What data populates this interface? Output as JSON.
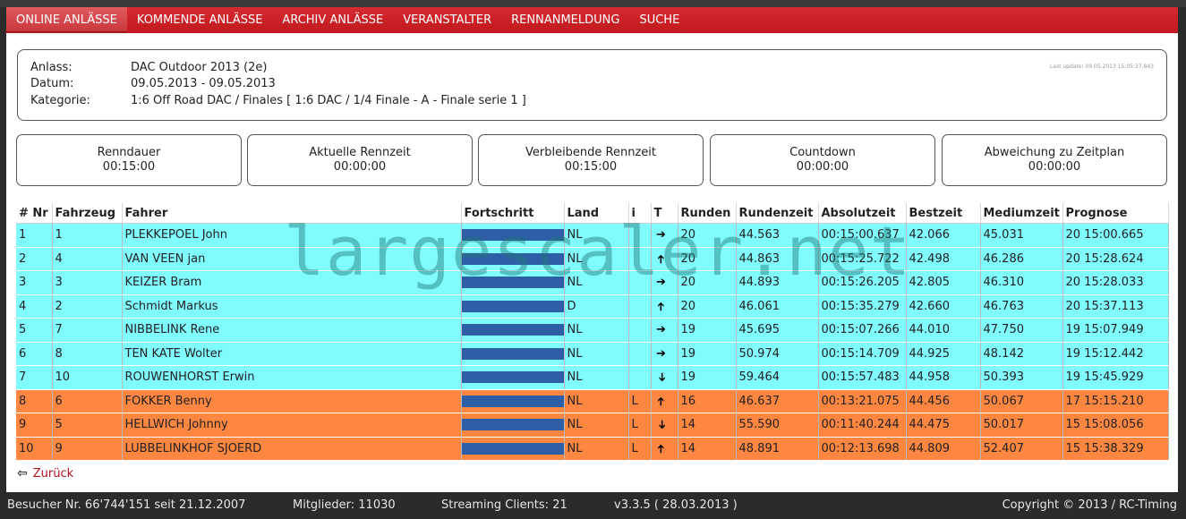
{
  "nav": {
    "items": [
      {
        "label": "ONLINE ANLÄSSE",
        "active": true
      },
      {
        "label": "KOMMENDE ANLÄSSE",
        "active": false
      },
      {
        "label": "ARCHIV ANLÄSSE",
        "active": false
      },
      {
        "label": "VERANSTALTER",
        "active": false
      },
      {
        "label": "RENNANMELDUNG",
        "active": false
      },
      {
        "label": "SUCHE",
        "active": false
      }
    ]
  },
  "info": {
    "anlass_label": "Anlass:",
    "anlass_value": "DAC Outdoor 2013 (2e)",
    "datum_label": "Datum:",
    "datum_value": "09.05.2013 - 09.05.2013",
    "kategorie_label": "Kategorie:",
    "kategorie_value": "1:6 Off Road DAC / Finales [ 1:6 DAC / 1/4 Finale - A - Finale serie 1 ]",
    "last_update": "Last update: 09.05.2013 15:05:37.843"
  },
  "timers": [
    {
      "label": "Renndauer",
      "value": "00:15:00"
    },
    {
      "label": "Aktuelle Rennzeit",
      "value": "00:00:00"
    },
    {
      "label": "Verbleibende Rennzeit",
      "value": "00:15:00"
    },
    {
      "label": "Countdown",
      "value": "00:00:00"
    },
    {
      "label": "Abweichung zu Zeitplan",
      "value": "00:00:00"
    }
  ],
  "table": {
    "headers": [
      "# Nr",
      "Fahrzeug",
      "Fahrer",
      "Fortschritt",
      "Land",
      "i",
      "T",
      "Runden",
      "Rundenzeit",
      "Absolutzeit",
      "Bestzeit",
      "Mediumzeit",
      "Prognose"
    ],
    "rows": [
      {
        "pos": "1",
        "car": "1",
        "driver": "PLEKKEPOEL John",
        "progress": 1.0,
        "country": "NL",
        "i": "",
        "trend": "east",
        "laps": "20",
        "laptime": "44.563",
        "abstime": "00:15:00.637",
        "best": "42.066",
        "medium": "45.031",
        "prognosis": "20 15:00.665",
        "group": "a"
      },
      {
        "pos": "2",
        "car": "4",
        "driver": "VAN VEEN jan",
        "progress": 1.0,
        "country": "NL",
        "i": "",
        "trend": "north",
        "laps": "20",
        "laptime": "44.863",
        "abstime": "00:15:25.722",
        "best": "42.498",
        "medium": "46.286",
        "prognosis": "20 15:28.624",
        "group": "a"
      },
      {
        "pos": "3",
        "car": "3",
        "driver": "KEIZER Bram",
        "progress": 1.0,
        "country": "NL",
        "i": "",
        "trend": "east",
        "laps": "20",
        "laptime": "44.893",
        "abstime": "00:15:26.205",
        "best": "42.805",
        "medium": "46.310",
        "prognosis": "20 15:28.033",
        "group": "a"
      },
      {
        "pos": "4",
        "car": "2",
        "driver": "Schmidt Markus",
        "progress": 1.0,
        "country": "D",
        "i": "",
        "trend": "north",
        "laps": "20",
        "laptime": "46.061",
        "abstime": "00:15:35.279",
        "best": "42.660",
        "medium": "46.763",
        "prognosis": "20 15:37.113",
        "group": "a"
      },
      {
        "pos": "5",
        "car": "7",
        "driver": "NIBBELINK Rene",
        "progress": 1.0,
        "country": "NL",
        "i": "",
        "trend": "east",
        "laps": "19",
        "laptime": "45.695",
        "abstime": "00:15:07.266",
        "best": "44.010",
        "medium": "47.750",
        "prognosis": "19 15:07.949",
        "group": "a"
      },
      {
        "pos": "6",
        "car": "8",
        "driver": "TEN KATE Wolter",
        "progress": 1.0,
        "country": "NL",
        "i": "",
        "trend": "east",
        "laps": "19",
        "laptime": "50.974",
        "abstime": "00:15:14.709",
        "best": "44.925",
        "medium": "48.142",
        "prognosis": "19 15:12.442",
        "group": "a"
      },
      {
        "pos": "7",
        "car": "10",
        "driver": "ROUWENHORST Erwin",
        "progress": 1.0,
        "country": "NL",
        "i": "",
        "trend": "south",
        "laps": "19",
        "laptime": "59.464",
        "abstime": "00:15:57.483",
        "best": "44.958",
        "medium": "50.393",
        "prognosis": "19 15:45.929",
        "group": "a"
      },
      {
        "pos": "8",
        "car": "6",
        "driver": "FOKKER Benny",
        "progress": 1.0,
        "country": "NL",
        "i": "L",
        "trend": "north",
        "laps": "16",
        "laptime": "46.637",
        "abstime": "00:13:21.075",
        "best": "44.456",
        "medium": "50.067",
        "prognosis": "17 15:15.210",
        "group": "b"
      },
      {
        "pos": "9",
        "car": "5",
        "driver": "HELLWICH Johnny",
        "progress": 1.0,
        "country": "NL",
        "i": "L",
        "trend": "south",
        "laps": "14",
        "laptime": "55.590",
        "abstime": "00:11:40.244",
        "best": "44.475",
        "medium": "50.017",
        "prognosis": "15 15:08.056",
        "group": "b"
      },
      {
        "pos": "10",
        "car": "9",
        "driver": "LUBBELINKHOF SJOERD",
        "progress": 1.0,
        "country": "NL",
        "i": "L",
        "trend": "north",
        "laps": "14",
        "laptime": "48.891",
        "abstime": "00:12:13.698",
        "best": "44.809",
        "medium": "52.407",
        "prognosis": "15 15:38.329",
        "group": "b"
      }
    ]
  },
  "back_label": "Zurück",
  "watermark": "largescaler.net",
  "footer": {
    "visitors": "Besucher Nr. 66'744'151 seit 21.12.2007",
    "members": "Mitglieder: 11030",
    "streaming": "Streaming Clients: 21",
    "version": "v3.3.5 ( 28.03.2013 )",
    "copyright": "Copyright © 2013 / RC-Timing"
  },
  "colors": {
    "nav_red": "#c8202a",
    "row_group_a": "#80fbfe",
    "row_group_b": "#fd8640",
    "progress_bar": "#2e5ea6"
  },
  "icons": {
    "trend_east": "arrow-right-icon",
    "trend_north": "arrow-up-icon",
    "trend_south": "arrow-down-icon",
    "back": "arrow-left-icon"
  }
}
